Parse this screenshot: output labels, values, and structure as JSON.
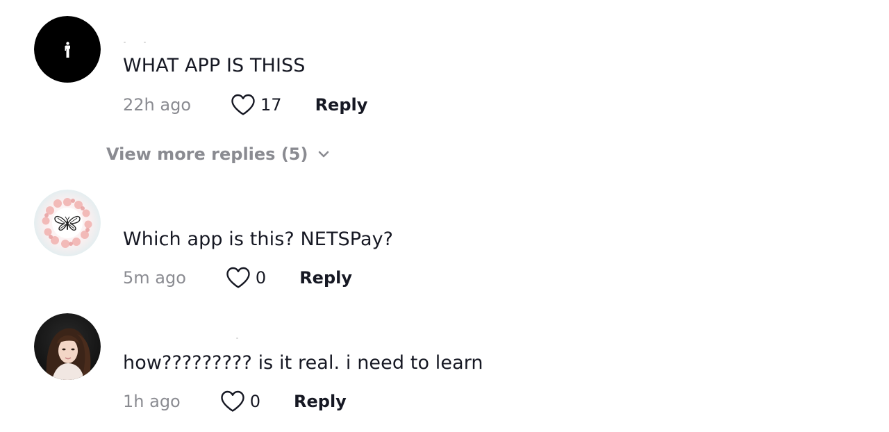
{
  "comments": [
    {
      "avatar": "black-avatar-with-figure-icon",
      "text": "WHAT APP IS THISS",
      "timestamp": "22h ago",
      "likes": "17",
      "reply_label": "Reply",
      "view_more": "View more replies (5)"
    },
    {
      "avatar": "butterfly-floral-avatar",
      "text": "Which app is this? NETSPay?",
      "timestamp": "5m ago",
      "likes": "0",
      "reply_label": "Reply"
    },
    {
      "avatar": "photo-avatar",
      "text": "how????????? is it real. i need to learn",
      "timestamp": "1h ago",
      "likes": "0",
      "reply_label": "Reply"
    }
  ],
  "colors": {
    "text_primary": "#161823",
    "text_secondary": "#8a8b91",
    "background": "#ffffff"
  }
}
